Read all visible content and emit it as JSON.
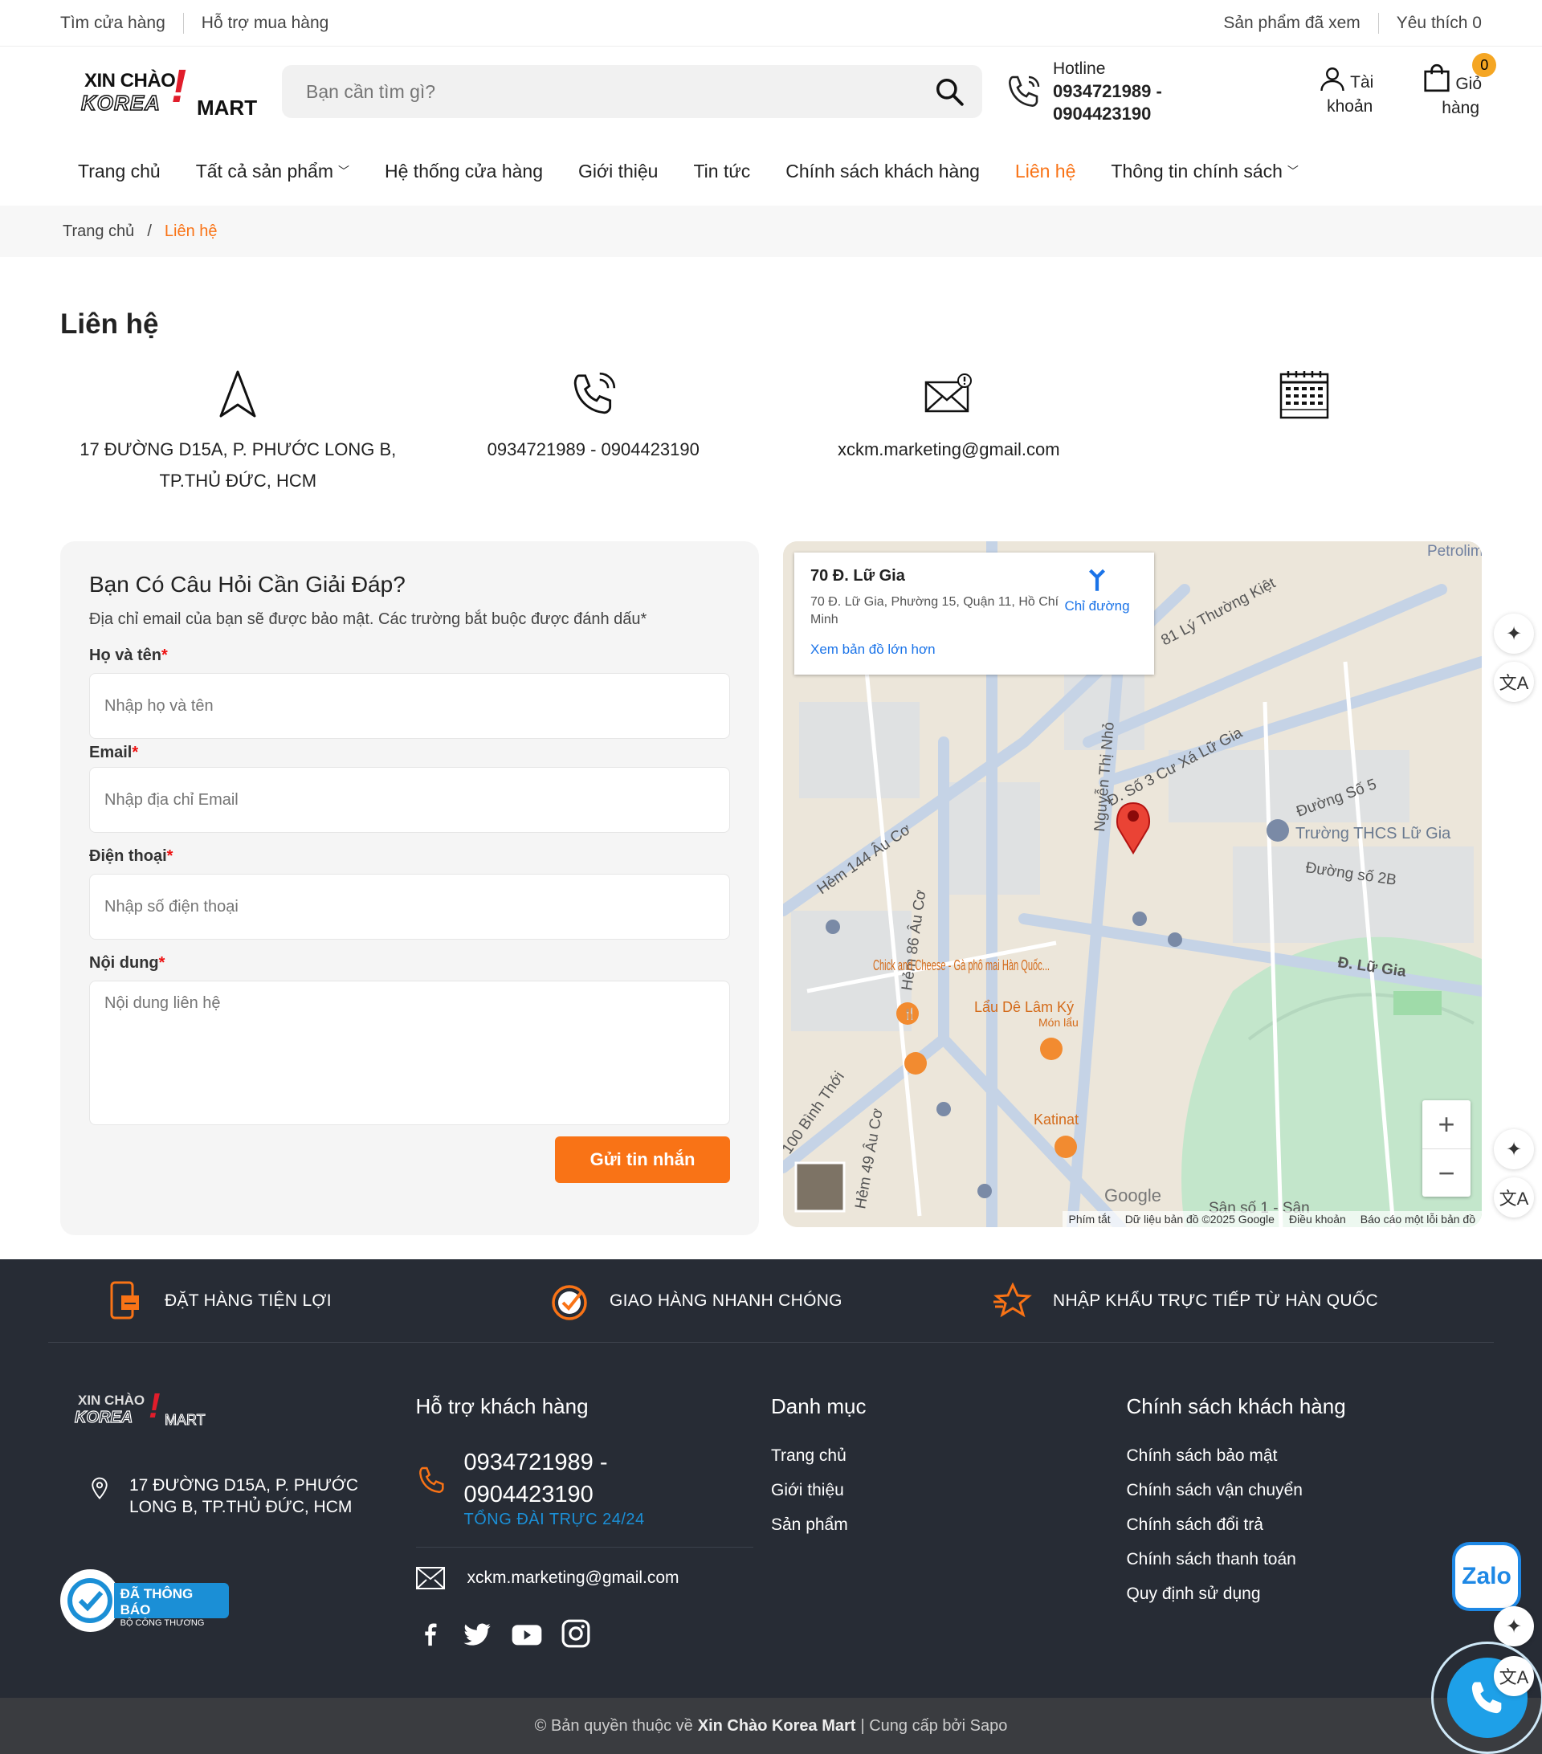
{
  "topbar": {
    "find_store": "Tìm cửa hàng",
    "support": "Hỗ trợ mua hàng",
    "viewed": "Sản phẩm đã xem",
    "favorites": "Yêu thích 0"
  },
  "logo": {
    "line1": "XIN CHÀO",
    "line2": "KOREA",
    "line3": "MART"
  },
  "search": {
    "placeholder": "Bạn cần tìm gì?"
  },
  "hotline": {
    "label": "Hotline",
    "number1": "0934721989 -",
    "number2": "0904423190"
  },
  "account": {
    "line1": "Tài",
    "line2": "khoản"
  },
  "cart": {
    "line1": "Giỏ",
    "line2": "hàng",
    "count": "0"
  },
  "nav": {
    "items": [
      "Trang chủ",
      "Tất cả sản phẩm",
      "Hệ thống cửa hàng",
      "Giới thiệu",
      "Tin tức",
      "Chính sách khách hàng",
      "Liên hệ",
      "Thông tin chính sách"
    ]
  },
  "breadcrumb": {
    "home": "Trang chủ",
    "sep": "/",
    "current": "Liên hệ"
  },
  "page_title": "Liên hệ",
  "contacts": {
    "address1": "17 ĐƯỜNG D15A, P. PHƯỚC LONG B,",
    "address2": "TP.THỦ ĐỨC, HCM",
    "phone": "0934721989 - 0904423190",
    "email": "xckm.marketing@gmail.com"
  },
  "form": {
    "title": "Bạn Có Câu Hỏi Cần Giải Đáp?",
    "note": "Địa chỉ email của bạn sẽ được bảo mật. Các trường bắt buộc được đánh dấu*",
    "name_label": "Họ và tên",
    "name_ph": "Nhập họ và tên",
    "email_label": "Email",
    "email_ph": "Nhập địa chỉ Email",
    "phone_label": "Điện thoại",
    "phone_ph": "Nhập số điện thoại",
    "content_label": "Nội dung",
    "content_ph": "Nội dung liên hệ",
    "req": "*",
    "submit": "Gửi tin nhắn"
  },
  "map": {
    "place": "70 Đ. Lữ Gia",
    "address": "70 Đ. Lữ Gia, Phường 15, Quận 11, Hồ Chí Minh",
    "directions": "Chỉ đường",
    "larger": "Xem bản đồ lớn hơn",
    "labels": [
      "81 Lý Thường Kiệt",
      "Đ. Số 3 Cư Xá Lữ Gia",
      "Đường Số 5",
      "Trường THCS Lữ Gia",
      "Đường số 2B",
      "Đ. Lữ Gia",
      "Nguyễn Thị Nhỏ",
      "Hẻm 144 Âu Cơ",
      "Hẻm 86 Âu Cơ",
      "Chick and Cheese - Gà phô mai Hàn Quốc...",
      "Lẩu Dê Lâm Ký",
      "Món lẩu",
      "Katinat",
      "100 Bình Thới",
      "Hẻm 49 Âu Cơ",
      "Petrolimex",
      "Sân số 1 - Sân"
    ],
    "google": "Google",
    "shortcuts": "Phím tắt",
    "mapdata": "Dữ liệu bản đồ ©2025 Google",
    "terms": "Điều khoản",
    "report": "Báo cáo một lỗi bản đồ",
    "zoom_in": "+",
    "zoom_out": "−"
  },
  "features": [
    "ĐẶT HÀNG TIỆN LỢI",
    "GIAO HÀNG NHANH CHÓNG",
    "NHẬP KHẨU TRỰC TIẾP TỪ HÀN QUỐC"
  ],
  "footer": {
    "address1": "17 ĐƯỜNG D15A, P. PHƯỚC",
    "address2": "LONG B, TP.THỦ ĐỨC, HCM",
    "badge1": "ĐÃ THÔNG BÁO",
    "badge2": "BỘ CÔNG THƯƠNG",
    "support_title": "Hỗ trợ khách hàng",
    "support_phone1": "0934721989 -",
    "support_phone2": "0904423190",
    "support_sub": "TỔNG ĐÀI TRỰC 24/24",
    "support_email": "xckm.marketing@gmail.com",
    "cat_title": "Danh mục",
    "cat_items": [
      "Trang chủ",
      "Giới thiệu",
      "Sản phẩm"
    ],
    "policy_title": "Chính sách khách hàng",
    "policy_items": [
      "Chính sách bảo mật",
      "Chính sách vận chuyển",
      "Chính sách đổi trả",
      "Chính sách thanh toán",
      "Quy định sử dụng"
    ]
  },
  "copyright": {
    "pre": "© Bản quyền thuộc về ",
    "brand": "Xin Chào Korea Mart",
    "post": " | Cung cấp bởi Sapo"
  },
  "zalo": "Zalo",
  "colors": {
    "accent": "#f97316",
    "footer_bg": "#272c35",
    "map_blue": "#1a73e8"
  }
}
